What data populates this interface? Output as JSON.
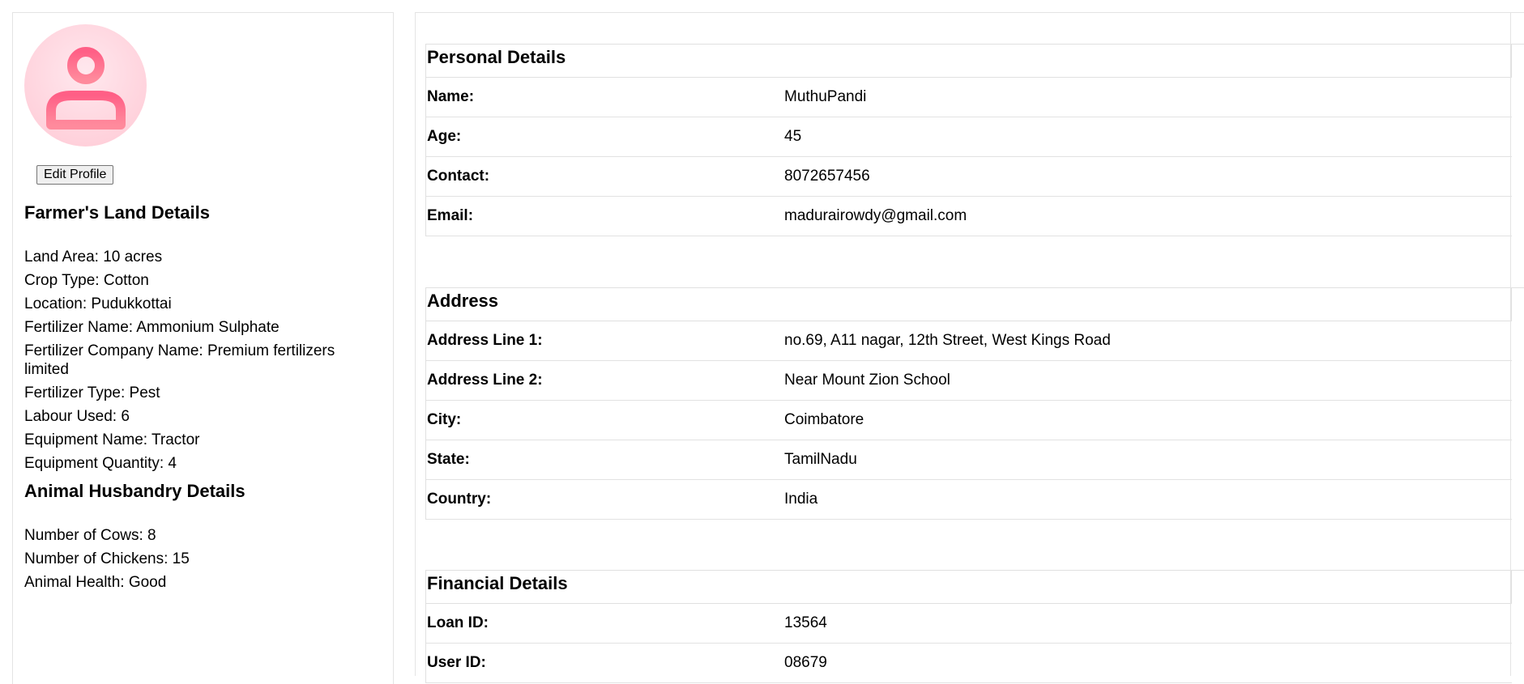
{
  "sidebar": {
    "edit_profile_label": "Edit Profile",
    "land_details": {
      "title": "Farmer's Land Details",
      "items": [
        "Land Area: 10 acres",
        "Crop Type: Cotton",
        "Location: Pudukkottai",
        "Fertilizer Name: Ammonium Sulphate",
        "Fertilizer Company Name: Premium fertilizers limited",
        "Fertilizer Type: Pest",
        "Labour Used: 6",
        "Equipment Name: Tractor",
        "Equipment Quantity: 4"
      ]
    },
    "animal_details": {
      "title": "Animal Husbandry Details",
      "items": [
        "Number of Cows: 8",
        "Number of Chickens: 15",
        "Animal Health: Good"
      ]
    }
  },
  "personal": {
    "title": "Personal Details",
    "rows": [
      {
        "label": "Name:",
        "value": "MuthuPandi"
      },
      {
        "label": "Age:",
        "value": "45"
      },
      {
        "label": "Contact:",
        "value": "8072657456"
      },
      {
        "label": "Email:",
        "value": "madurairowdy@gmail.com"
      }
    ]
  },
  "address": {
    "title": "Address",
    "rows": [
      {
        "label": "Address Line 1:",
        "value": "no.69, A11 nagar, 12th Street, West Kings Road"
      },
      {
        "label": "Address Line 2:",
        "value": "Near Mount Zion School"
      },
      {
        "label": "City:",
        "value": "Coimbatore"
      },
      {
        "label": "State:",
        "value": "TamilNadu"
      },
      {
        "label": "Country:",
        "value": "India"
      }
    ]
  },
  "financial": {
    "title": "Financial Details",
    "rows": [
      {
        "label": "Loan ID:",
        "value": "13564"
      },
      {
        "label": "User ID:",
        "value": "08679"
      }
    ]
  },
  "colors": {
    "avatar_bg": "#ffd2dc",
    "avatar_icon": "#ff6f8e"
  },
  "icons": {
    "avatar": "user-icon"
  }
}
